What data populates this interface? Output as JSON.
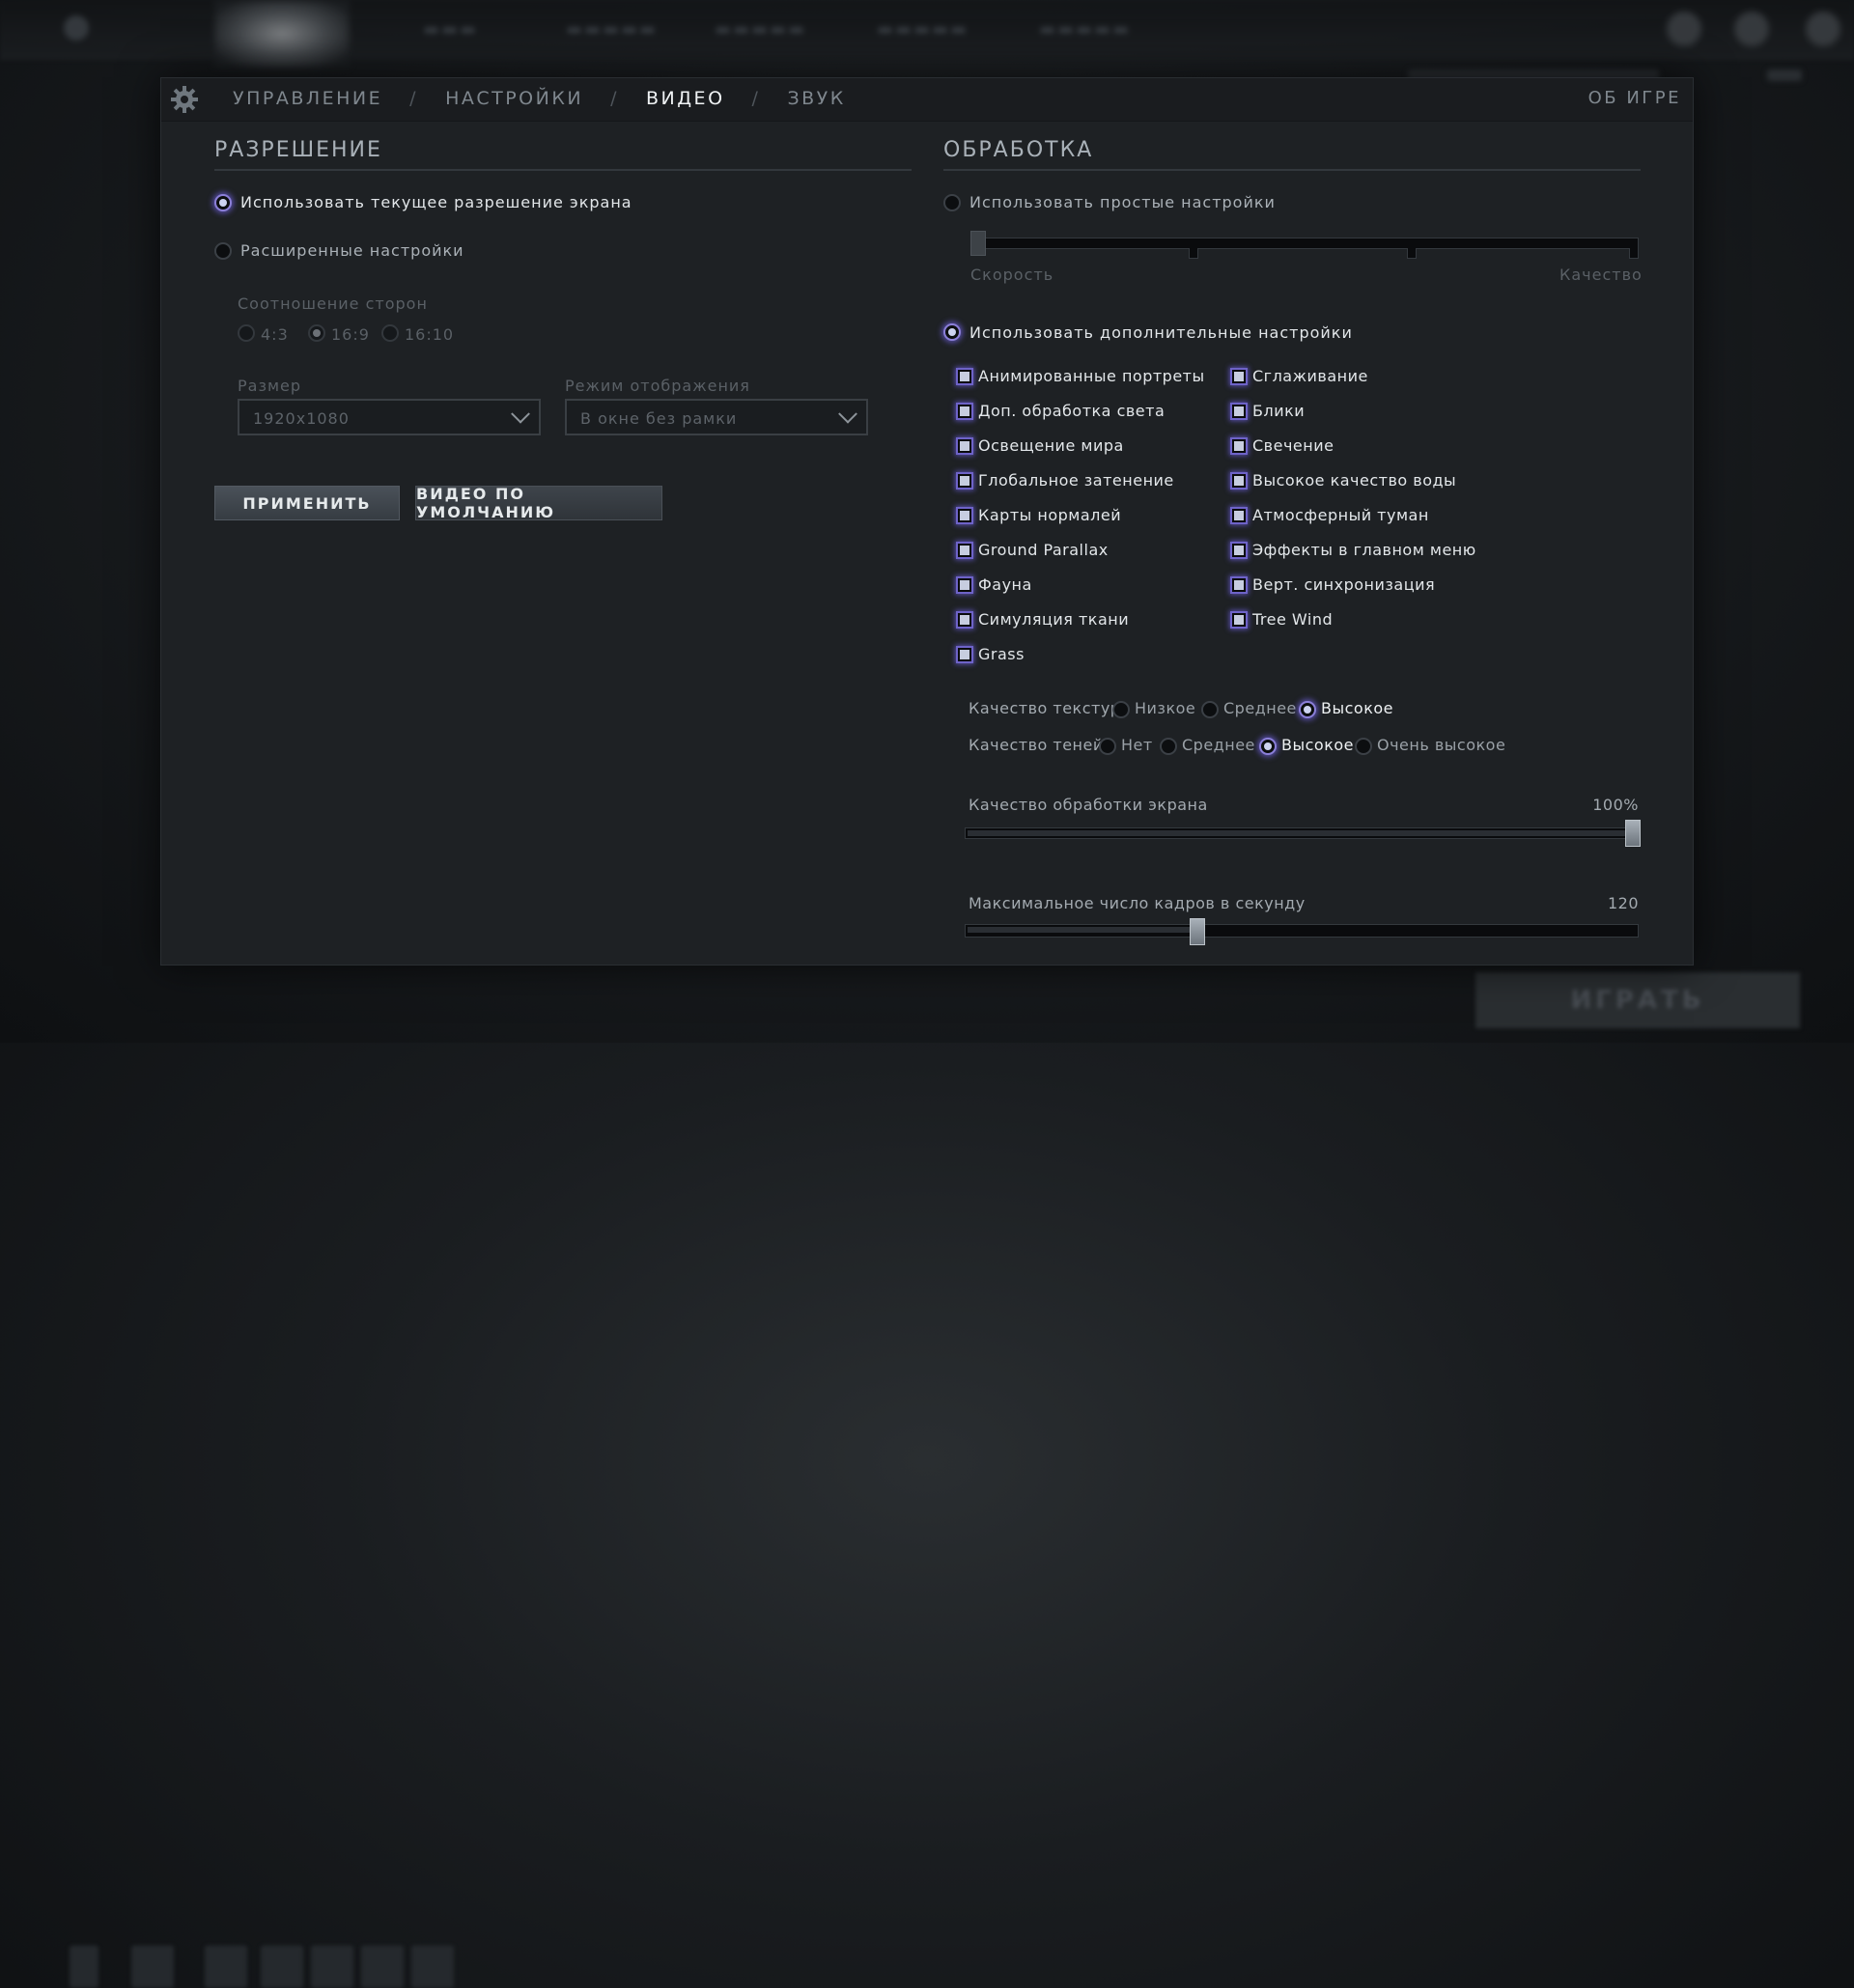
{
  "header": {
    "tabs": [
      "УПРАВЛЕНИЕ",
      "НАСТРОЙКИ",
      "ВИДЕО",
      "ЗВУК"
    ],
    "separator": "/",
    "about": "ОБ ИГРЕ"
  },
  "resolution": {
    "title": "РАЗРЕШЕНИЕ",
    "use_current": "Использовать текущее разрешение экрана",
    "advanced": "Расширенные настройки",
    "aspect_label": "Соотношение сторон",
    "aspect_options": [
      "4:3",
      "16:9",
      "16:10"
    ],
    "size_label": "Размер",
    "size_value": "1920x1080",
    "mode_label": "Режим отображения",
    "mode_value": "В окне без рамки",
    "apply_button": "ПРИМЕНИТЬ",
    "default_button": "ВИДЕО ПО УМОЛЧАНИЮ"
  },
  "rendering": {
    "title": "ОБРАБОТКА",
    "use_simple": "Использовать простые настройки",
    "speed_label": "Скорость",
    "quality_label": "Качество",
    "use_advanced": "Использовать дополнительные настройки",
    "checkboxes_left": [
      "Анимированные портреты",
      "Доп. обработка света",
      "Освещение мира",
      "Глобальное затенение",
      "Карты нормалей",
      "Ground Parallax",
      "Фауна",
      "Симуляция ткани",
      "Grass"
    ],
    "checkboxes_right": [
      "Сглаживание",
      "Блики",
      "Свечение",
      "Высокое качество воды",
      "Атмосферный туман",
      "Эффекты в главном меню",
      "Верт. синхронизация",
      "Tree Wind"
    ],
    "texture_label": "Качество текстур",
    "texture_options": [
      "Низкое",
      "Среднее",
      "Высокое"
    ],
    "texture_selected": "Высокое",
    "shadow_label": "Качество теней",
    "shadow_options": [
      "Нет",
      "Среднее",
      "Высокое",
      "Очень высокое"
    ],
    "shadow_selected": "Высокое",
    "screen_quality_label": "Качество обработки экрана",
    "screen_quality_value": "100%",
    "screen_quality_fraction": 1.0,
    "fps_label": "Максимальное число кадров в секунду",
    "fps_value": "120",
    "fps_fraction": 0.34
  },
  "bottom": {
    "play_button": "ИГРАТЬ"
  }
}
